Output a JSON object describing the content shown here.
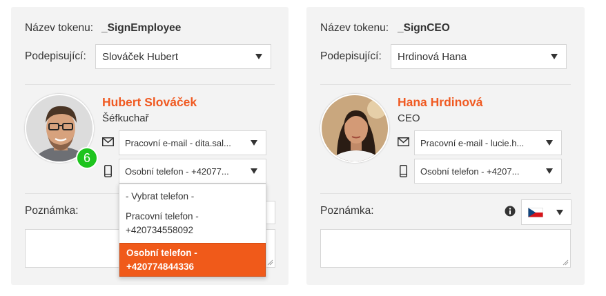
{
  "left": {
    "token_label": "Název tokenu:",
    "token_value": "_SignEmployee",
    "signer_label": "Podepisující:",
    "signer_value": "Slováček Hubert",
    "person_name": "Hubert Slováček",
    "person_role": "Šéfkuchař",
    "email_value": "Pracovní e-mail - dita.sal...",
    "phone_value": "Osobní telefon - +42077...",
    "badge": "6",
    "note_label": "Poznámka:",
    "phone_options": [
      {
        "line1": "- Vybrat telefon -",
        "line2": ""
      },
      {
        "line1": "Pracovní telefon -",
        "line2": "+420734558092"
      },
      {
        "line1": "Osobní telefon -",
        "line2": "+420774844336"
      }
    ]
  },
  "right": {
    "token_label": "Název tokenu:",
    "token_value": "_SignCEO",
    "signer_label": "Podepisující:",
    "signer_value": "Hrdinová Hana",
    "person_name": "Hana Hrdinová",
    "person_role": "CEO",
    "email_value": "Pracovní e-mail - lucie.h...",
    "phone_value": "Osobní telefon - +4207...",
    "note_label": "Poznámka:"
  },
  "colors": {
    "accent": "#f05a22",
    "badge": "#1ec41e",
    "card_bg": "#f3f3f3"
  },
  "icons": {
    "email": "envelope-icon",
    "phone": "mobile-phone-icon",
    "info": "info-icon",
    "flag": "czech-flag-icon"
  }
}
